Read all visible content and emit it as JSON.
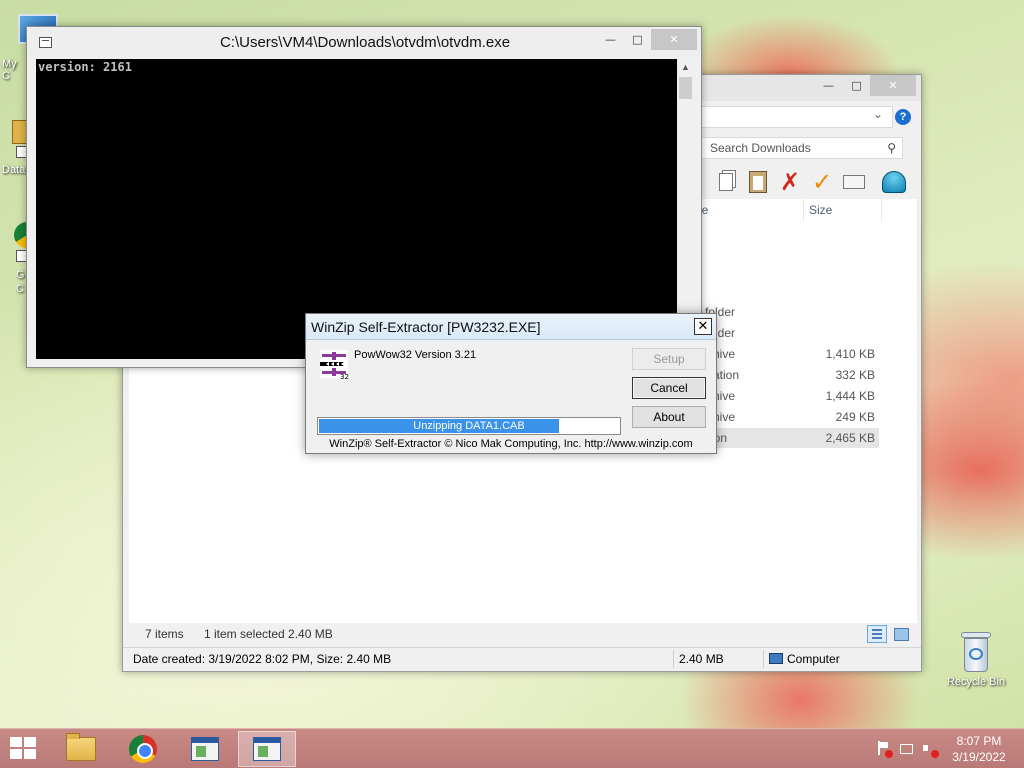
{
  "desktop": {
    "icons": [
      {
        "label": "My C"
      },
      {
        "label": "Data"
      },
      {
        "label_line1": "G",
        "label_line2": "C"
      },
      {
        "label": "Recycle Bin"
      }
    ]
  },
  "console": {
    "title": "C:\\Users\\VM4\\Downloads\\otvdm\\otvdm.exe",
    "output": "version: 2161",
    "buttons": {
      "minimize": "—",
      "maximize": "□",
      "close": "✕"
    }
  },
  "explorer": {
    "search_placeholder": "Search Downloads",
    "columns": {
      "type": "pe",
      "size": "Size"
    },
    "rows": [
      {
        "type": "e folder",
        "size": ""
      },
      {
        "type": "e folder",
        "size": ""
      },
      {
        "type": " Archive",
        "size": "1,410 KB"
      },
      {
        "type": "plication",
        "size": "332 KB"
      },
      {
        "type": " Archive",
        "size": "1,444 KB"
      },
      {
        "type": " Archive",
        "size": "249 KB"
      },
      {
        "type": "cation",
        "size": "2,465 KB",
        "selected": true
      }
    ],
    "status": {
      "items": "7 items",
      "selection": "1 item selected  2.40 MB"
    },
    "details_bar": {
      "created": "Date created: 3/19/2022 8:02 PM, Size: 2.40 MB",
      "size": "2.40 MB",
      "location": "Computer"
    },
    "buttons": {
      "minimize": "—",
      "maximize": "□",
      "close": "✕",
      "help": "?"
    }
  },
  "winzip": {
    "title": "WinZip Self-Extractor [PW3232.EXE]",
    "product": "PowWow32 Version 3.21",
    "logo_badge": "32",
    "buttons": {
      "setup": "Setup",
      "cancel": "Cancel",
      "about": "About"
    },
    "progress_text": "Unzipping DATA1.CAB",
    "progress_fraction": 0.8,
    "footer": "WinZip® Self-Extractor  © Nico Mak Computing, Inc.  http://www.winzip.com",
    "close": "✕"
  },
  "taskbar": {
    "clock_time": "8:07 PM",
    "clock_date": "3/19/2022"
  }
}
